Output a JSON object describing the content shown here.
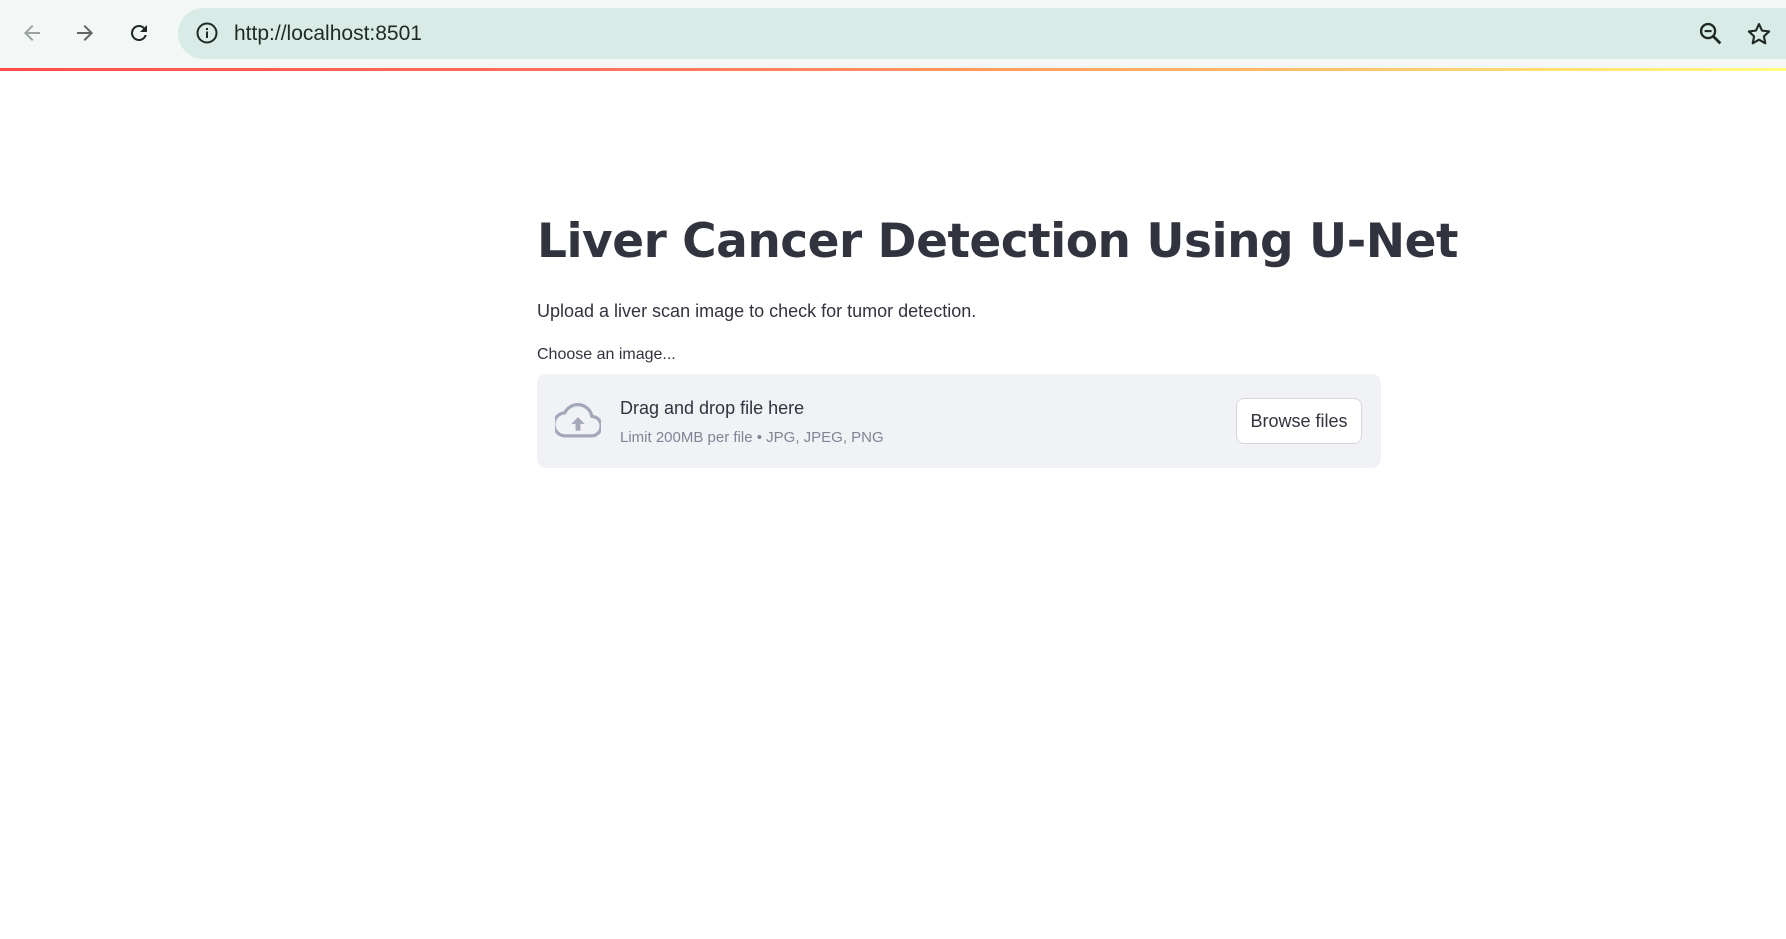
{
  "browser": {
    "url": "http://localhost:8501",
    "icons": {
      "back": "arrow-left",
      "forward": "arrow-right",
      "reload": "refresh",
      "info": "info-circle",
      "zoom": "magnifier-minus",
      "bookmark": "star-outline"
    }
  },
  "app": {
    "title": "Liver Cancer Detection Using U-Net",
    "subtitle": "Upload a liver scan image to check for tumor detection.",
    "uploader": {
      "label": "Choose an image...",
      "drop_title": "Drag and drop file here",
      "drop_limits": "Limit 200MB per file • JPG, JPEG, PNG",
      "browse_label": "Browse files"
    }
  },
  "colors": {
    "text": "#31333f",
    "muted": "#808495",
    "dropzone_bg": "#f0f2f6",
    "address_bar": "#d8ebe6",
    "accent_start": "#ff4b4b",
    "accent_end": "#fffd80"
  }
}
